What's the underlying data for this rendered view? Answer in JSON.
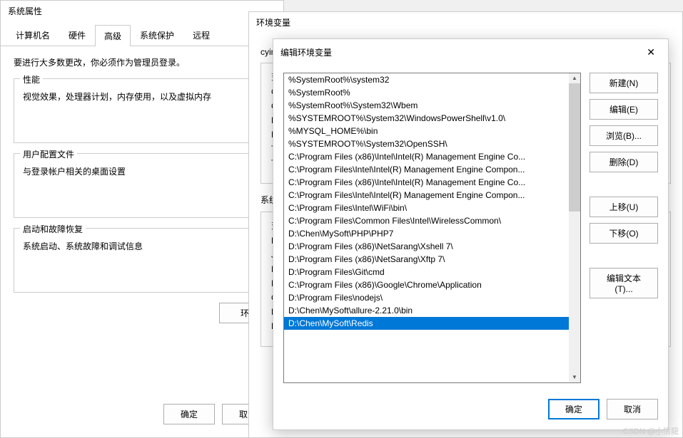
{
  "sys_props": {
    "title": "系统属性",
    "tabs": [
      "计算机名",
      "硬件",
      "高级",
      "系统保护",
      "远程"
    ],
    "active_tab": 2,
    "message": "要进行大多数更改，你必须作为管理员登录。",
    "perf": {
      "legend": "性能",
      "desc": "视觉效果，处理器计划，内存使用，以及虚拟内存"
    },
    "user_profile": {
      "legend": "用户配置文件",
      "desc": "与登录帐户相关的桌面设置"
    },
    "startup": {
      "legend": "启动和故障恢复",
      "desc": "系统启动、系统故障和调试信息"
    },
    "env_btn": "环",
    "ok": "确定",
    "cancel": "取消"
  },
  "env_dialog": {
    "title": "环境变量",
    "user_label": "cyin",
    "user_vars_cols": [
      "变",
      "O",
      "O",
      "Pa",
      "Pt",
      "TE",
      "TM"
    ],
    "sys_label": "系统",
    "sys_vars_cols": [
      "变",
      "Dr",
      "JA",
      "M",
      "N",
      "O",
      "Pa",
      "PA"
    ]
  },
  "edit_dialog": {
    "title": "编辑环境变量",
    "paths": [
      "%SystemRoot%\\system32",
      "%SystemRoot%",
      "%SystemRoot%\\System32\\Wbem",
      "%SYSTEMROOT%\\System32\\WindowsPowerShell\\v1.0\\",
      "%MYSQL_HOME%\\bin",
      "%SYSTEMROOT%\\System32\\OpenSSH\\",
      "C:\\Program Files (x86)\\Intel\\Intel(R) Management Engine Co...",
      "C:\\Program Files\\Intel\\Intel(R) Management Engine Compon...",
      "C:\\Program Files (x86)\\Intel\\Intel(R) Management Engine Co...",
      "C:\\Program Files\\Intel\\Intel(R) Management Engine Compon...",
      "C:\\Program Files\\Intel\\WiFi\\bin\\",
      "C:\\Program Files\\Common Files\\Intel\\WirelessCommon\\",
      "D:\\Chen\\MySoft\\PHP\\PHP7",
      "D:\\Program Files (x86)\\NetSarang\\Xshell 7\\",
      "D:\\Program Files (x86)\\NetSarang\\Xftp 7\\",
      "D:\\Program Files\\Git\\cmd",
      "C:\\Program Files (x86)\\Google\\Chrome\\Application",
      "D:\\Program Files\\nodejs\\",
      "D:\\Chen\\MySoft\\allure-2.21.0\\bin",
      "D:\\Chen\\MySoft\\Redis"
    ],
    "selected_index": 19,
    "buttons": {
      "new": "新建(N)",
      "edit": "编辑(E)",
      "browse": "浏览(B)...",
      "delete": "删除(D)",
      "up": "上移(U)",
      "down": "下移(O)",
      "edit_text": "编辑文本(T)..."
    },
    "ok": "确定",
    "cancel": "取消"
  },
  "watermark": "CSDN @小情龍"
}
